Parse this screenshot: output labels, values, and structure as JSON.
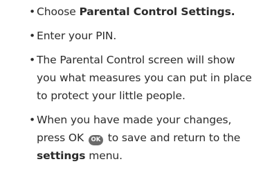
{
  "bullet_char": "•",
  "items": [
    {
      "before": "Choose ",
      "bold": "Parental Control Settings.",
      "after": ""
    },
    {
      "text": "Enter your PIN."
    },
    {
      "text": "The Parental Control screen will show you what measures you can put in place to protect your little people."
    },
    {
      "before": "When you have made your changes, press OK ",
      "button_label": "OK",
      "middle": " to save and return to the ",
      "bold": "settings",
      "after": " menu."
    }
  ]
}
